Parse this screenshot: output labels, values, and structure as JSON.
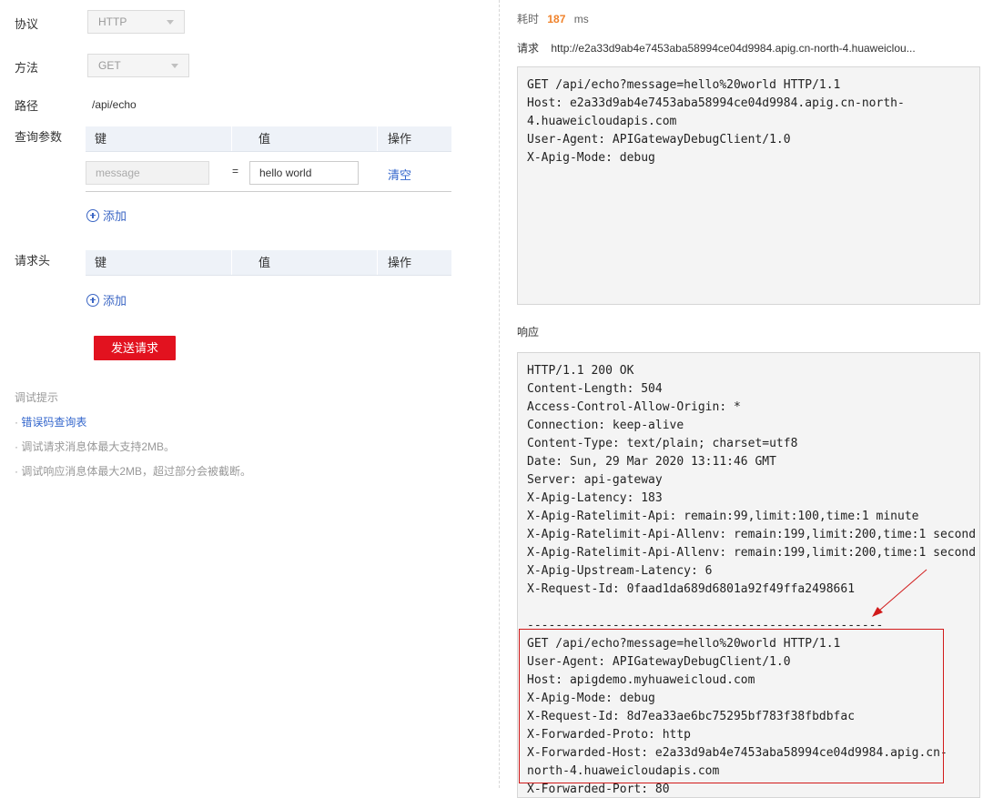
{
  "form": {
    "protocol_label": "协议",
    "protocol_value": "HTTP",
    "method_label": "方法",
    "method_value": "GET",
    "path_label": "路径",
    "path_value": "/api/echo",
    "query_label": "查询参数",
    "query_table": {
      "headers": [
        "键",
        "值",
        "操作"
      ],
      "row": {
        "key_placeholder": "message",
        "equals": "=",
        "value": "hello world",
        "action": "清空"
      }
    },
    "add_label": "添加",
    "headers_label": "请求头",
    "headers_table": {
      "headers": [
        "键",
        "值",
        "操作"
      ]
    },
    "send_button": "发送请求"
  },
  "tips": {
    "title": "调试提示",
    "items": [
      {
        "text": "错误码查询表",
        "is_link": true
      },
      {
        "text": "调试请求消息体最大支持2MB。",
        "is_link": false
      },
      {
        "text": "调试响应消息体最大2MB，超过部分会被截断。",
        "is_link": false
      }
    ]
  },
  "result": {
    "duration_label": "耗时",
    "duration_value": "187",
    "duration_unit": "ms",
    "request_label": "请求",
    "request_url": "http://e2a33d9ab4e7453aba58994ce04d9984.apig.cn-north-4.huaweiclou...",
    "request_lines": [
      "GET /api/echo?message=hello%20world HTTP/1.1",
      "Host: e2a33d9ab4e7453aba58994ce04d9984.apig.cn-north-",
      "4.huaweicloudapis.com",
      "User-Agent: APIGatewayDebugClient/1.0",
      "X-Apig-Mode: debug"
    ],
    "response_label": "响应",
    "response_lines": [
      "HTTP/1.1 200 OK",
      "Content-Length: 504",
      "Access-Control-Allow-Origin: *",
      "Connection: keep-alive",
      "Content-Type: text/plain; charset=utf8",
      "Date: Sun, 29 Mar 2020 13:11:46 GMT",
      "Server: api-gateway",
      "X-Apig-Latency: 183",
      "X-Apig-Ratelimit-Api: remain:99,limit:100,time:1 minute",
      "X-Apig-Ratelimit-Api-Allenv: remain:199,limit:200,time:1 second",
      "X-Apig-Ratelimit-Api-Allenv: remain:199,limit:200,time:1 second",
      "X-Apig-Upstream-Latency: 6",
      "X-Request-Id: 0faad1da689d6801a92f49ffa2498661",
      "",
      "--------------------------------------------------",
      "GET /api/echo?message=hello%20world HTTP/1.1",
      "User-Agent: APIGatewayDebugClient/1.0",
      "Host: apigdemo.myhuaweicloud.com",
      "X-Apig-Mode: debug",
      "X-Request-Id: 8d7ea33ae6bc75295bf783f38fbdbfac",
      "X-Forwarded-Proto: http",
      "X-Forwarded-Host: e2a33d9ab4e7453aba58994ce04d9984.apig.cn-",
      "north-4.huaweicloudapis.com",
      "X-Forwarded-Port: 80"
    ]
  },
  "colors": {
    "accent_red": "#e2121f",
    "link_blue": "#3366cc",
    "duration_orange": "#f0822a",
    "annotation_red": "#d11a1a"
  }
}
